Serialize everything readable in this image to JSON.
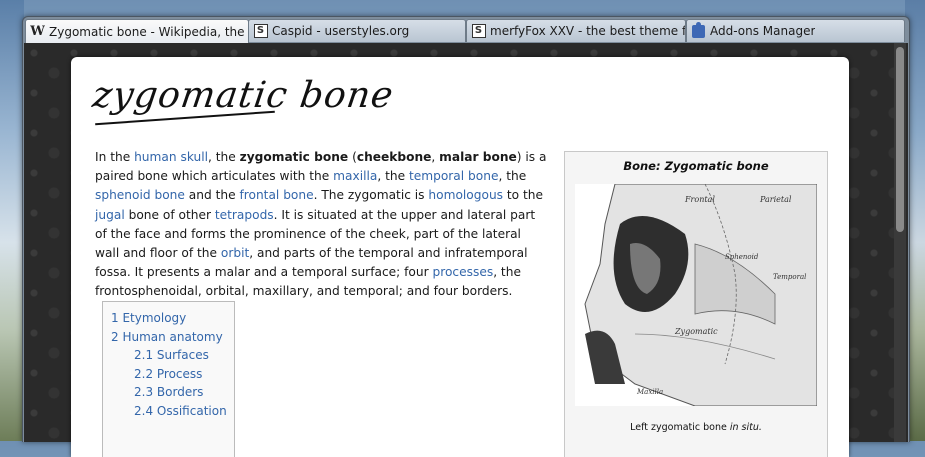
{
  "tabs": [
    {
      "label": "Zygomatic bone - Wikipedia, the fr...",
      "icon": "wikipedia-icon",
      "active": true
    },
    {
      "label": "Caspid - userstyles.org",
      "icon": "userstyles-icon",
      "active": false
    },
    {
      "label": "merfyFox XXV - the best theme for ...",
      "icon": "userstyles-icon",
      "active": false
    },
    {
      "label": "Add-ons Manager",
      "icon": "puzzle-icon",
      "active": false
    }
  ],
  "article": {
    "heading": "zygomatic bone",
    "intro": {
      "p1": "In the ",
      "link_human_skull": "human skull",
      "p2": ", the ",
      "b1": "zygomatic bone",
      "p3": " (",
      "b2": "cheekbone",
      "p4": ", ",
      "b3": "malar bone",
      "p5": ") is a paired bone which articulates with the ",
      "link_maxilla": "maxilla",
      "p6": ", the ",
      "link_temporal": "temporal bone",
      "p7": ", the ",
      "link_sphenoid": "sphenoid bone",
      "p8": " and the ",
      "link_frontal": "frontal bone",
      "p9": ". The zygomatic is ",
      "link_homologous": "homologous",
      "p10": " to the ",
      "link_jugal": "jugal",
      "p11": " bone of other ",
      "link_tetrapods": "tetrapods",
      "p12": ". It is situated at the upper and lateral part of the face and forms the prominence of the cheek, part of the lateral wall and floor of the ",
      "link_orbit": "orbit",
      "p13": ", and parts of the temporal and infratemporal fossa. It presents a malar and a temporal surface; four ",
      "link_processes": "processes",
      "p14": ", the frontosphenoidal, orbital, maxillary, and temporal; and four borders."
    },
    "toc": [
      {
        "label": "1 Etymology",
        "sub": false
      },
      {
        "label": "2 Human anatomy",
        "sub": false
      },
      {
        "label": "2.1 Surfaces",
        "sub": true
      },
      {
        "label": "2.2 Process",
        "sub": true
      },
      {
        "label": "2.3 Borders",
        "sub": true
      },
      {
        "label": "2.4 Ossification",
        "sub": true
      }
    ],
    "infobox": {
      "title": "Bone: Zygomatic bone",
      "image_labels": [
        "Frontal",
        "Parietal",
        "Sphenoid",
        "Temporal",
        "Zygomatic",
        "Maxilla"
      ],
      "caption_prefix": "Left zygomatic bone ",
      "caption_italic": "in situ."
    }
  }
}
